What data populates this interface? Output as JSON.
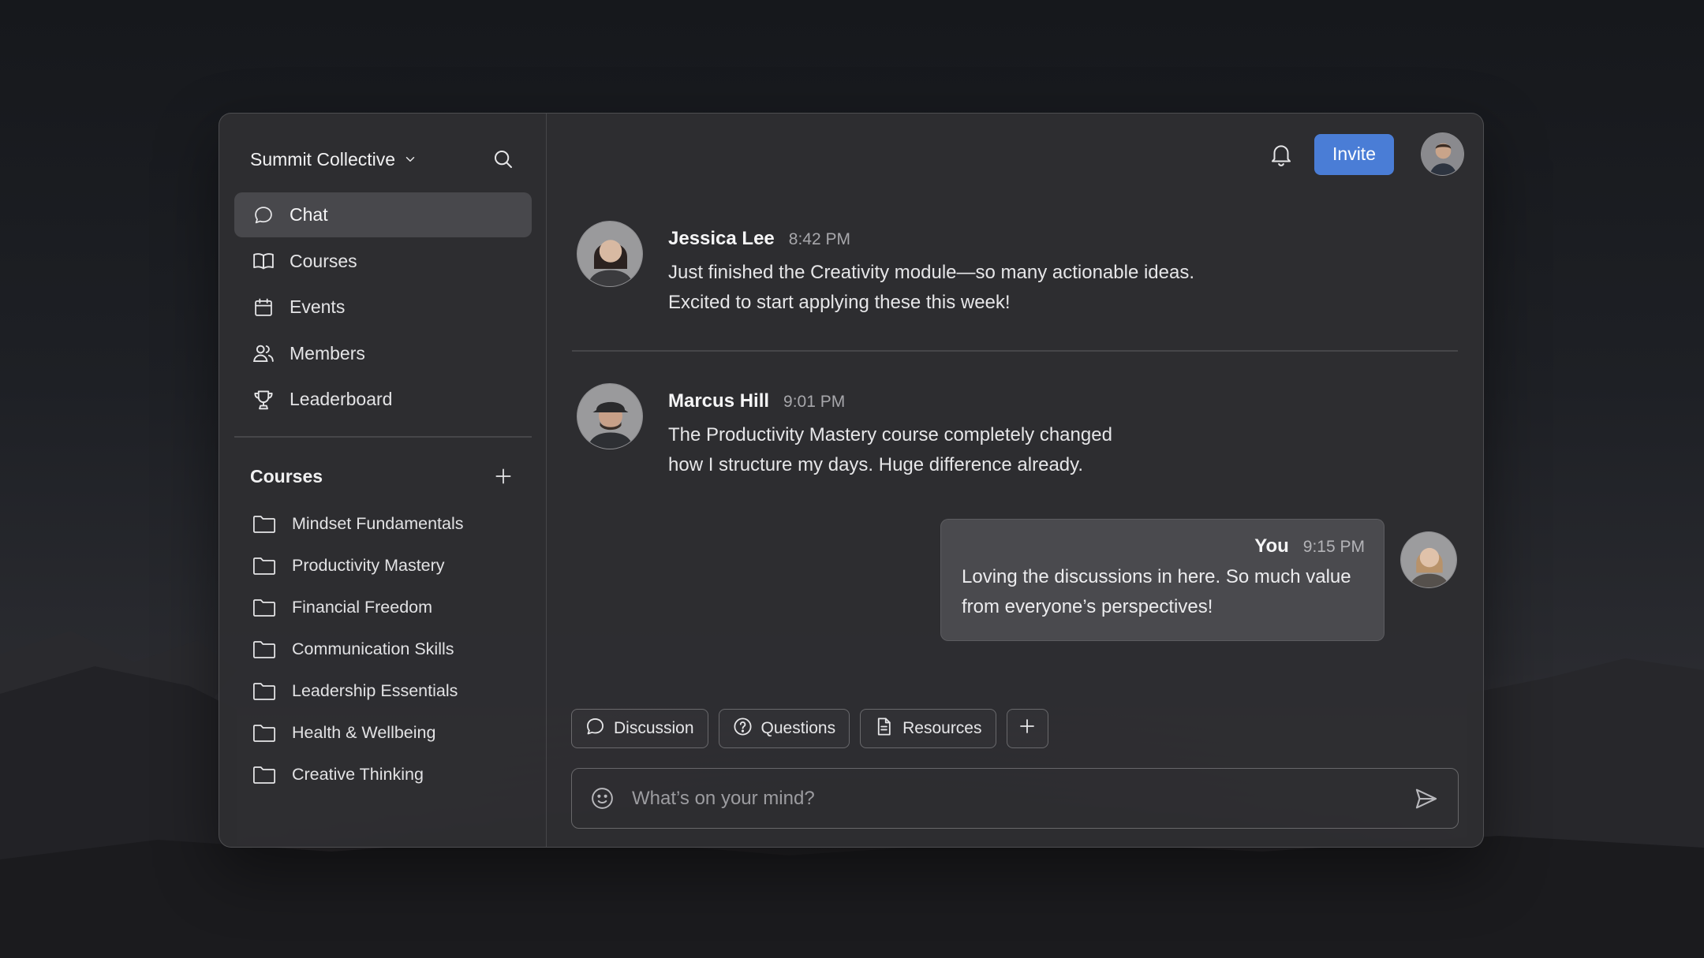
{
  "sidebar": {
    "workspace_name": "Summit Collective",
    "nav": [
      {
        "label": "Chat",
        "icon": "chat-bubble-icon",
        "active": true
      },
      {
        "label": "Courses",
        "icon": "book-icon",
        "active": false
      },
      {
        "label": "Events",
        "icon": "calendar-icon",
        "active": false
      },
      {
        "label": "Members",
        "icon": "users-icon",
        "active": false
      },
      {
        "label": "Leaderboard",
        "icon": "trophy-icon",
        "active": false
      }
    ],
    "courses_heading": "Courses",
    "courses": [
      "Mindset Fundamentals",
      "Productivity Mastery",
      "Financial Freedom",
      "Communication Skills",
      "Leadership Essentials",
      "Health & Wellbeing",
      "Creative Thinking"
    ]
  },
  "topbar": {
    "invite_label": "Invite"
  },
  "messages": [
    {
      "author": "Jessica Lee",
      "time": "8:42 PM",
      "lines": [
        "Just finished the Creativity module—so many actionable ideas.",
        "Excited to start applying these this week!"
      ]
    },
    {
      "author": "Marcus Hill",
      "time": "9:01 PM",
      "lines": [
        "The Productivity Mastery course completely changed",
        "how I structure my days. Huge difference already."
      ]
    }
  ],
  "my_message": {
    "author": "You",
    "time": "9:15 PM",
    "lines": [
      "Loving the discussions in here. So much value",
      "from everyone’s perspectives!"
    ]
  },
  "chips": [
    {
      "label": "Discussion",
      "icon": "chat-bubble-icon"
    },
    {
      "label": "Questions",
      "icon": "question-circle-icon"
    },
    {
      "label": "Resources",
      "icon": "document-icon"
    }
  ],
  "composer": {
    "placeholder": "What’s on your mind?"
  },
  "colors": {
    "accent": "#4a7dd6",
    "window_bg": "#2e2e31",
    "active_nav_bg": "#48484c"
  }
}
